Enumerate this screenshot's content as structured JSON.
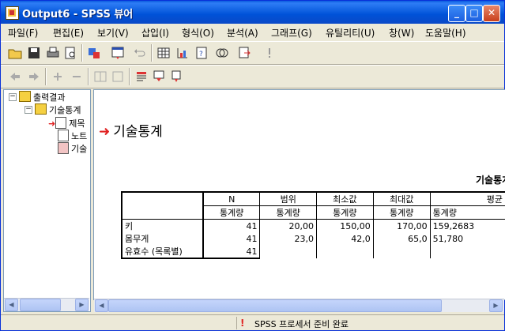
{
  "window": {
    "title": "Output6 - SPSS 뷰어"
  },
  "menu": [
    "파일(F)",
    "편집(E)",
    "보기(V)",
    "삽입(I)",
    "형식(O)",
    "분석(A)",
    "그래프(G)",
    "유틸리티(U)",
    "창(W)",
    "도움말(H)"
  ],
  "tree": {
    "root": "출력결과",
    "group": "기술통계",
    "items": [
      "제목",
      "노트",
      "기술"
    ]
  },
  "content": {
    "heading": "기술통계",
    "table_title": "기술통계",
    "table": {
      "col_headers": [
        "N",
        "범위",
        "최소값",
        "최대값",
        "평균"
      ],
      "sub_headers": [
        "통계량",
        "통계량",
        "통계량",
        "통계량",
        "통계량"
      ],
      "rows": [
        {
          "label": "키",
          "values": [
            "41",
            "20,00",
            "150,00",
            "170,00",
            "159,2683"
          ]
        },
        {
          "label": "몸무게",
          "values": [
            "41",
            "23,0",
            "42,0",
            "65,0",
            "51,780"
          ]
        },
        {
          "label": "유효수 (목록별)",
          "values": [
            "41",
            "",
            "",
            "",
            ""
          ]
        }
      ]
    }
  },
  "status": {
    "text": "SPSS 프로세서  준비 완료"
  },
  "colors": {
    "titlebar": "#0a5bde",
    "accent_red": "#e02020",
    "chrome": "#ece9d8"
  }
}
